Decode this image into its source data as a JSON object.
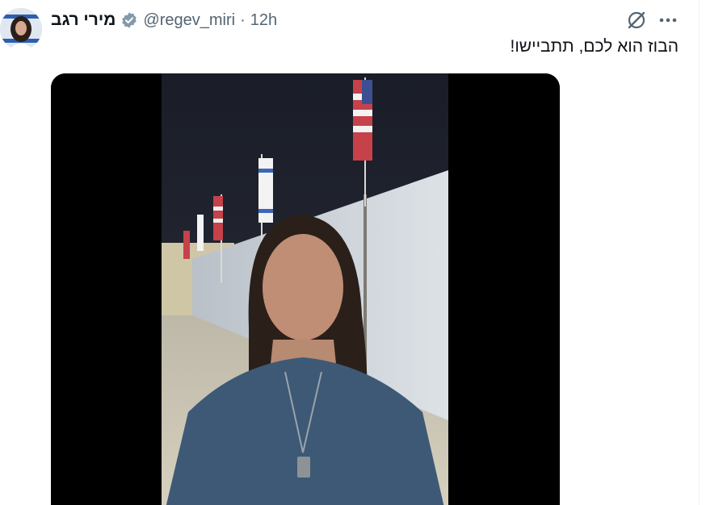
{
  "tweet": {
    "display_name": "מירי רגב",
    "handle": "@regev_miri",
    "separator": "·",
    "time": "12h",
    "text": "הבוז הוא לכם, תתביישו!"
  },
  "icons": {
    "verified": "verified-badge-icon",
    "grok": "grok-icon",
    "more": "more-horizontal-icon"
  },
  "colors": {
    "verified_badge": "#829aab",
    "secondary_text": "#536471"
  }
}
